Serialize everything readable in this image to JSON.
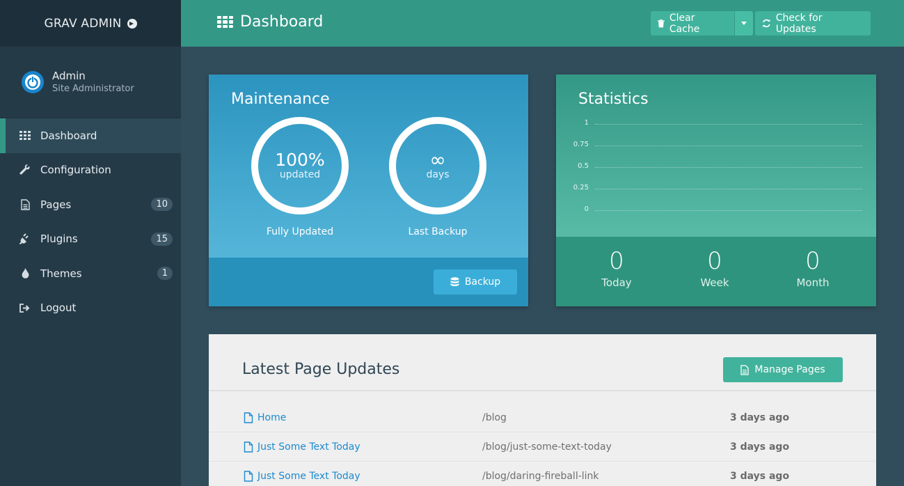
{
  "brand": {
    "name": "GRAV ADMIN"
  },
  "user": {
    "name": "Admin",
    "role": "Site Administrator"
  },
  "nav": [
    {
      "label": "Dashboard",
      "icon": "grid-icon",
      "active": true
    },
    {
      "label": "Configuration",
      "icon": "wrench-icon"
    },
    {
      "label": "Pages",
      "icon": "file-icon",
      "badge": "10"
    },
    {
      "label": "Plugins",
      "icon": "plug-icon",
      "badge": "15"
    },
    {
      "label": "Themes",
      "icon": "tint-icon",
      "badge": "1"
    },
    {
      "label": "Logout",
      "icon": "sign-out-icon"
    }
  ],
  "topbar": {
    "title": "Dashboard",
    "clear_cache": "Clear Cache",
    "check_updates": "Check for Updates"
  },
  "maintenance": {
    "title": "Maintenance",
    "updated_value": "100%",
    "updated_unit": "updated",
    "updated_label": "Fully Updated",
    "backup_value": "∞",
    "backup_unit": "days",
    "backup_label": "Last Backup",
    "backup_button": "Backup"
  },
  "statistics": {
    "title": "Statistics",
    "yticks": [
      "1",
      "0.75",
      "0.5",
      "0.25",
      "0"
    ],
    "today_value": "0",
    "today_label": "Today",
    "week_value": "0",
    "week_label": "Week",
    "month_value": "0",
    "month_label": "Month"
  },
  "updates": {
    "title": "Latest Page Updates",
    "manage_button": "Manage Pages",
    "rows": [
      {
        "title": "Home",
        "route": "/blog",
        "date": "3 days ago"
      },
      {
        "title": "Just Some Text Today",
        "route": "/blog/just-some-text-today",
        "date": "3 days ago"
      },
      {
        "title": "Just Some Text Today",
        "route": "/blog/daring-fireball-link",
        "date": "3 days ago"
      }
    ]
  },
  "colors": {
    "accent": "#349886",
    "sidebar": "#253a47",
    "maintenance": "#2b94bf",
    "link": "#1b8acf"
  }
}
